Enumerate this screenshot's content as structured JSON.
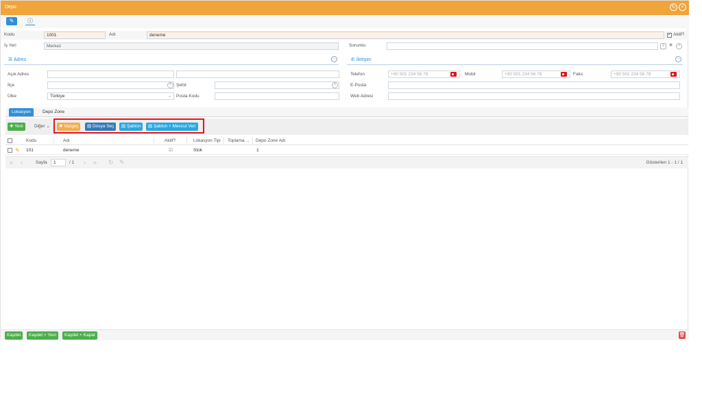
{
  "window": {
    "title": "Depo"
  },
  "toolbar": {
    "edit_icon": "edit-icon",
    "info_icon": "info-icon"
  },
  "form": {
    "kodu_label": "Kodu",
    "kodu_value": "1001",
    "adi_label": "Adı",
    "adi_value": "deneme",
    "aktif_label": "Aktif?",
    "aktif_checked": true,
    "isyeri_label": "İş Yeri",
    "isyeri_value": "Merkez",
    "sorumlu_label": "Sorumlu",
    "sorumlu_value": ""
  },
  "adres": {
    "title": "Adres",
    "acik_adres_label": "Açık Adres",
    "acik_adres_value": "",
    "acik_adres_value2": "",
    "ilce_label": "İlçe",
    "ilce_value": "",
    "sehir_label": "Şehir",
    "sehir_value": "",
    "ulke_label": "Ülke",
    "ulke_value": "Türkiye",
    "posta_kodu_label": "Posta Kodu",
    "posta_kodu_value": ""
  },
  "iletisim": {
    "title": "İletişim",
    "telefon_label": "Telefon",
    "telefon_placeholder": "+90 501 234 56 78",
    "mobil_label": "Mobil",
    "mobil_placeholder": "+90 501 234 56 78",
    "faks_label": "Faks",
    "faks_placeholder": "+90 501 234 56 78",
    "eposta_label": "E-Posta",
    "eposta_value": "",
    "web_label": "Web Adresi",
    "web_value": ""
  },
  "tabs": [
    {
      "label": "Lokasyon",
      "active": true
    },
    {
      "label": "Depo Zone",
      "active": false
    }
  ],
  "grid_toolbar": {
    "yeni": "Yeni",
    "diger": "Diğer",
    "vazgec": "Vazgeç",
    "dosya_sec": "Dosya Seç",
    "sablon": "Şablon",
    "sablon_mevcut": "Şablon + Mevcut Veri"
  },
  "grid": {
    "columns": [
      "Kodu",
      "Adı",
      "Aktif?",
      "Lokasyon Tipi",
      "Toplama ...",
      "Depo Zone Adı"
    ],
    "rows": [
      {
        "kodu": "101",
        "adi": "deneme",
        "aktif": true,
        "lokasyon_tipi": "Stok",
        "toplama": "1",
        "depo_zone_adi": ""
      }
    ]
  },
  "pager": {
    "sayfa_label": "Sayfa",
    "page": "1",
    "of": "/ 1",
    "summary": "Gösterilen 1 - 1 / 1"
  },
  "footer": {
    "kaydet": "Kaydet",
    "kaydet_yeni": "Kaydet + Yeni",
    "kaydet_kapat": "Kaydet + Kapat"
  },
  "colors": {
    "titlebar": "#f0a43a",
    "accent": "#2f8fd8",
    "highlight_box": "#e8111b"
  }
}
